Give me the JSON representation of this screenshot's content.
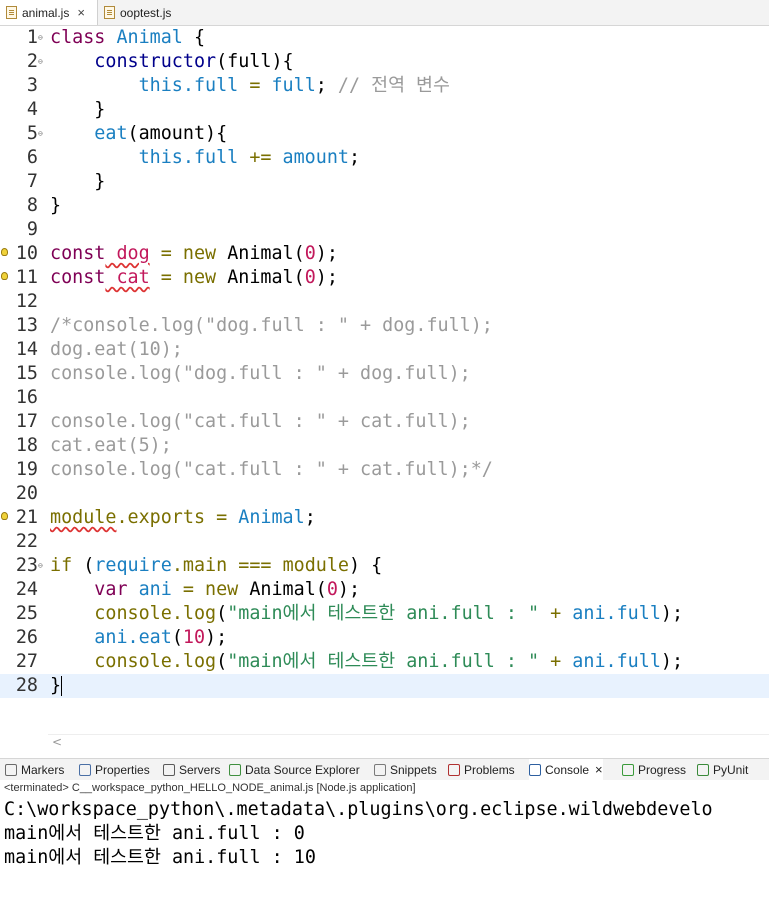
{
  "editor_tabs": [
    {
      "label": "animal.js",
      "active": true,
      "closable": true
    },
    {
      "label": "ooptest.js",
      "active": false
    }
  ],
  "code": {
    "current_line": 28,
    "lines": [
      {
        "n": "1",
        "fold": true,
        "tokens": [
          [
            "k",
            "class"
          ],
          [
            "",
            ""
          ],
          [
            "id",
            " Animal"
          ],
          [
            "",
            " {"
          ]
        ]
      },
      {
        "n": "2",
        "fold": true,
        "tokens": [
          [
            "",
            "    "
          ],
          [
            "kb",
            "constructor"
          ],
          [
            "",
            "(full){"
          ]
        ]
      },
      {
        "n": "3",
        "tokens": [
          [
            "",
            "        "
          ],
          [
            "id",
            "this"
          ],
          [
            "",
            ""
          ],
          [
            "id",
            ".full"
          ],
          [
            "op",
            " ="
          ],
          [
            "id",
            " full"
          ],
          [
            "",
            ";"
          ],
          [
            "cm",
            " // 전역 변수"
          ]
        ]
      },
      {
        "n": "4",
        "tokens": [
          [
            "",
            "    }"
          ]
        ]
      },
      {
        "n": "5",
        "fold": true,
        "tokens": [
          [
            "",
            "    "
          ],
          [
            "id",
            "eat"
          ],
          [
            "",
            "(amount){"
          ]
        ]
      },
      {
        "n": "6",
        "tokens": [
          [
            "",
            "        "
          ],
          [
            "id",
            "this"
          ],
          [
            "id",
            ".full"
          ],
          [
            "op",
            " +="
          ],
          [
            "id",
            " amount"
          ],
          [
            "",
            ";"
          ]
        ]
      },
      {
        "n": "7",
        "tokens": [
          [
            "",
            "    }"
          ]
        ]
      },
      {
        "n": "8",
        "tokens": [
          [
            "",
            "}"
          ]
        ]
      },
      {
        "n": "9",
        "tokens": []
      },
      {
        "n": "10",
        "warn": true,
        "tokens": [
          [
            "k",
            "const"
          ],
          [
            "",
            ""
          ],
          [
            "nm sq",
            " dog"
          ],
          [
            "op",
            " ="
          ],
          [
            "op",
            " new"
          ],
          [
            "",
            " Animal("
          ],
          [
            "nm",
            "0"
          ],
          [
            "",
            ");"
          ]
        ]
      },
      {
        "n": "11",
        "warn": true,
        "tokens": [
          [
            "k",
            "const"
          ],
          [
            "",
            ""
          ],
          [
            "nm sq",
            " cat"
          ],
          [
            "op",
            " ="
          ],
          [
            "op",
            " new"
          ],
          [
            "",
            " Animal("
          ],
          [
            "nm",
            "0"
          ],
          [
            "",
            ");"
          ]
        ]
      },
      {
        "n": "12",
        "tokens": []
      },
      {
        "n": "13",
        "tokens": [
          [
            "cm",
            "/*console.log(\"dog.full : \" + dog.full);"
          ]
        ]
      },
      {
        "n": "14",
        "tokens": [
          [
            "cm",
            "dog.eat(10);"
          ]
        ]
      },
      {
        "n": "15",
        "tokens": [
          [
            "cm",
            "console.log(\"dog.full : \" + dog.full);"
          ]
        ]
      },
      {
        "n": "16",
        "tokens": []
      },
      {
        "n": "17",
        "tokens": [
          [
            "cm",
            "console.log(\"cat.full : \" + cat.full);"
          ]
        ]
      },
      {
        "n": "18",
        "tokens": [
          [
            "cm",
            "cat.eat(5);"
          ]
        ]
      },
      {
        "n": "19",
        "tokens": [
          [
            "cm",
            "console.log(\"cat.full : \" + cat.full);*/"
          ]
        ]
      },
      {
        "n": "20",
        "tokens": []
      },
      {
        "n": "21",
        "warn": true,
        "tokens": [
          [
            "op sq",
            "module"
          ],
          [
            "",
            ""
          ],
          [
            "op",
            ".exports"
          ],
          [
            "op",
            " ="
          ],
          [
            "id",
            " Animal"
          ],
          [
            "",
            ";"
          ]
        ]
      },
      {
        "n": "22",
        "tokens": []
      },
      {
        "n": "23",
        "fold": true,
        "tokens": [
          [
            "op",
            "if"
          ],
          [
            "",
            " ("
          ],
          [
            "id",
            "require"
          ],
          [
            "op",
            ".main"
          ],
          [
            "op",
            " ==="
          ],
          [
            "op",
            " module"
          ],
          [
            "",
            ") {"
          ]
        ]
      },
      {
        "n": "24",
        "tokens": [
          [
            "",
            "    "
          ],
          [
            "k",
            "var"
          ],
          [
            "id",
            " ani"
          ],
          [
            "op",
            " ="
          ],
          [
            "op",
            " new"
          ],
          [
            "",
            " Animal("
          ],
          [
            "nm",
            "0"
          ],
          [
            "",
            ");"
          ]
        ]
      },
      {
        "n": "25",
        "tokens": [
          [
            "",
            "    "
          ],
          [
            "op",
            "console"
          ],
          [
            "op",
            ".log"
          ],
          [
            "",
            "("
          ],
          [
            "st",
            "\"main에서 테스트한 ani.full : \""
          ],
          [
            "op",
            " +"
          ],
          [
            "id",
            " ani"
          ],
          [
            "id",
            ".full"
          ],
          [
            "",
            ");"
          ]
        ]
      },
      {
        "n": "26",
        "tokens": [
          [
            "",
            "    "
          ],
          [
            "id",
            "ani"
          ],
          [
            "id",
            ".eat"
          ],
          [
            "",
            "("
          ],
          [
            "nm",
            "10"
          ],
          [
            "",
            ");"
          ]
        ]
      },
      {
        "n": "27",
        "tokens": [
          [
            "",
            "    "
          ],
          [
            "op",
            "console"
          ],
          [
            "op",
            ".log"
          ],
          [
            "",
            "("
          ],
          [
            "st",
            "\"main에서 테스트한 ani.full : \""
          ],
          [
            "op",
            " +"
          ],
          [
            "id",
            " ani"
          ],
          [
            "id",
            ".full"
          ],
          [
            "",
            ");"
          ]
        ]
      },
      {
        "n": "28",
        "tokens": [
          [
            "",
            "}"
          ]
        ]
      }
    ]
  },
  "scroll_arrow": "<",
  "views": [
    {
      "label": "Markers",
      "icon": "markers-icon"
    },
    {
      "label": "Properties",
      "icon": "properties-icon"
    },
    {
      "label": "Servers",
      "icon": "servers-icon"
    },
    {
      "label": "Data Source Explorer",
      "icon": "data-source-icon"
    },
    {
      "label": "Snippets",
      "icon": "snippets-icon"
    },
    {
      "label": "Problems",
      "icon": "problems-icon"
    },
    {
      "label": "Console",
      "icon": "console-icon",
      "active": true
    },
    {
      "label": "Progress",
      "icon": "progress-icon"
    },
    {
      "label": "PyUnit",
      "icon": "pyunit-icon"
    }
  ],
  "console": {
    "status": "<terminated> C__workspace_python_HELLO_NODE_animal.js [Node.js application]",
    "lines": [
      "C:\\workspace_python\\.metadata\\.plugins\\org.eclipse.wildwebdevelo",
      "main에서 테스트한 ani.full : 0",
      "main에서 테스트한 ani.full : 10"
    ]
  }
}
